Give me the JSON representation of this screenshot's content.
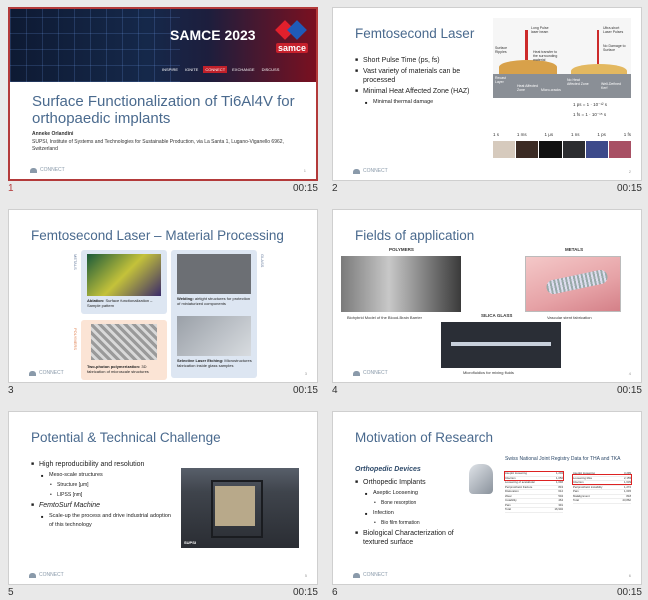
{
  "slides": [
    {
      "number": "1",
      "duration": "00:15",
      "selected": true,
      "event_title": "SAMCE 2023",
      "logo_text": "samce",
      "nav_items": [
        "INSPIRE",
        "IGNITE",
        "CONNECT",
        "EXCHANGE",
        "DISCUSS"
      ],
      "title": "Surface Functionalization of Ti6Al4V for orthopaedic implants",
      "author": "Anneke Orlandini",
      "affiliation": "SUPSI, Institute of Systems and Technologies for Sustainable Production, via La Santa 1, Lugano-Viganello 6962, Switzerland",
      "footer_logo": "CONNECT",
      "page_no": "1"
    },
    {
      "number": "2",
      "duration": "00:15",
      "title": "Femtosecond Laser",
      "bullets": [
        {
          "level": 1,
          "text": "Short Pulse Time (ps, fs)"
        },
        {
          "level": 1,
          "text": "Vast variety of materials can be processed"
        },
        {
          "level": 1,
          "text": "Minimal Heat Affected Zone (HAZ)"
        },
        {
          "level": 2,
          "text": "Minimal thermal damage"
        }
      ],
      "diagram_labels": [
        "Surface Ripples",
        "Long Pulse laser beam",
        "Heat transfer to the surrounding material",
        "Ultra-short Laser Pulses",
        "Recast Layer",
        "Heat Affected Zone",
        "Micro-cracks",
        "No Damage to Surface",
        "No Heat Affected Zone",
        "Well-Defined Kerf"
      ],
      "equations": [
        "1 ps = 1 · 10⁻¹² s",
        "1 fs = 1 · 10⁻¹⁵ s"
      ],
      "timeline": [
        "1 s",
        "1 ms",
        "1 μs",
        "1 ns",
        "1 ps",
        "1 fs"
      ],
      "footer_logo": "CONNECT",
      "page_no": "2"
    },
    {
      "number": "3",
      "duration": "00:15",
      "title": "Femtosecond Laser – Material Processing",
      "side_labels": [
        "METALS",
        "POLYMERS",
        "GLASS"
      ],
      "captions": [
        {
          "bold": "Ablation:",
          "text": " Surface functionalization – Sample pattern"
        },
        {
          "bold": "Two-photon polymerization:",
          "text": " 3D fabrication of microscale structures"
        },
        {
          "bold": "Welding:",
          "text": " airtight structures for protection of miniaturized components"
        },
        {
          "bold": "Selective Laser Etching:",
          "text": " Microstructures fabrication inside glass samples"
        }
      ],
      "footer_logo": "CONNECT",
      "page_no": "3"
    },
    {
      "number": "4",
      "duration": "00:15",
      "title": "Fields of application",
      "labels": [
        "POLYMERS",
        "METALS",
        "SILICA GLASS"
      ],
      "captions": [
        "Biohybrid Model of the Blood-Brain Barrier",
        "Vascular stent fabrication",
        "Microfluidics for mixing fluids"
      ],
      "footer_logo": "CONNECT",
      "page_no": "4"
    },
    {
      "number": "5",
      "duration": "00:15",
      "title": "Potential & Technical Challenge",
      "bullets": [
        {
          "level": 1,
          "text": "High reproducibility and resolution",
          "italic": false
        },
        {
          "level": 2,
          "text": "Meso-scale structures"
        },
        {
          "level": 3,
          "text": "Structure [μm]"
        },
        {
          "level": 3,
          "text": "LIPSS [nm]"
        },
        {
          "level": 1,
          "text": "FemtoSurf Machine",
          "italic": true
        },
        {
          "level": 2,
          "text": "Scale-up the process and drive industrial adoption of this technology"
        }
      ],
      "image_tag": "SUPSI",
      "footer_logo": "CONNECT",
      "page_no": "5"
    },
    {
      "number": "6",
      "duration": "00:15",
      "title": "Motivation of Research",
      "subtitle": "Orthopedic Devices",
      "bullets": [
        {
          "level": 1,
          "text": "Orthopedic Implants"
        },
        {
          "level": 2,
          "text": "Aseptic Loosening"
        },
        {
          "level": 3,
          "text": "Bone resorption"
        },
        {
          "level": 2,
          "text": "Infection"
        },
        {
          "level": 3,
          "text": "Bio film formation"
        },
        {
          "level": 1,
          "text": "Biological Characterization of textured surface"
        }
      ],
      "table_title": "Swiss National Joint Registry Data for THA and TKA",
      "table_left": [
        [
          "Aseptic loosening",
          "1,202"
        ],
        [
          "Infection",
          "1,050"
        ],
        [
          "Loosening of acetabular",
          "1,046"
        ],
        [
          "Periprosthetic fracture",
          "843"
        ],
        [
          "Dislocation",
          "612"
        ],
        [
          "Wear",
          "504"
        ],
        [
          "Instability",
          "464"
        ],
        [
          "Pain",
          "391"
        ],
        [
          "Total",
          "16,904"
        ]
      ],
      "table_right": [
        [
          "Aseptic loosening",
          "3,299"
        ],
        [
          "Loosening tibia",
          "2,155"
        ],
        [
          "Infection",
          "1,639"
        ],
        [
          "Periprosthetic instability",
          "1,272"
        ],
        [
          "Pain",
          "1,045"
        ],
        [
          "Malalignment",
          "818"
        ],
        [
          "Total",
          "23,862"
        ]
      ],
      "footer_logo": "CONNECT",
      "page_no": "6"
    }
  ]
}
